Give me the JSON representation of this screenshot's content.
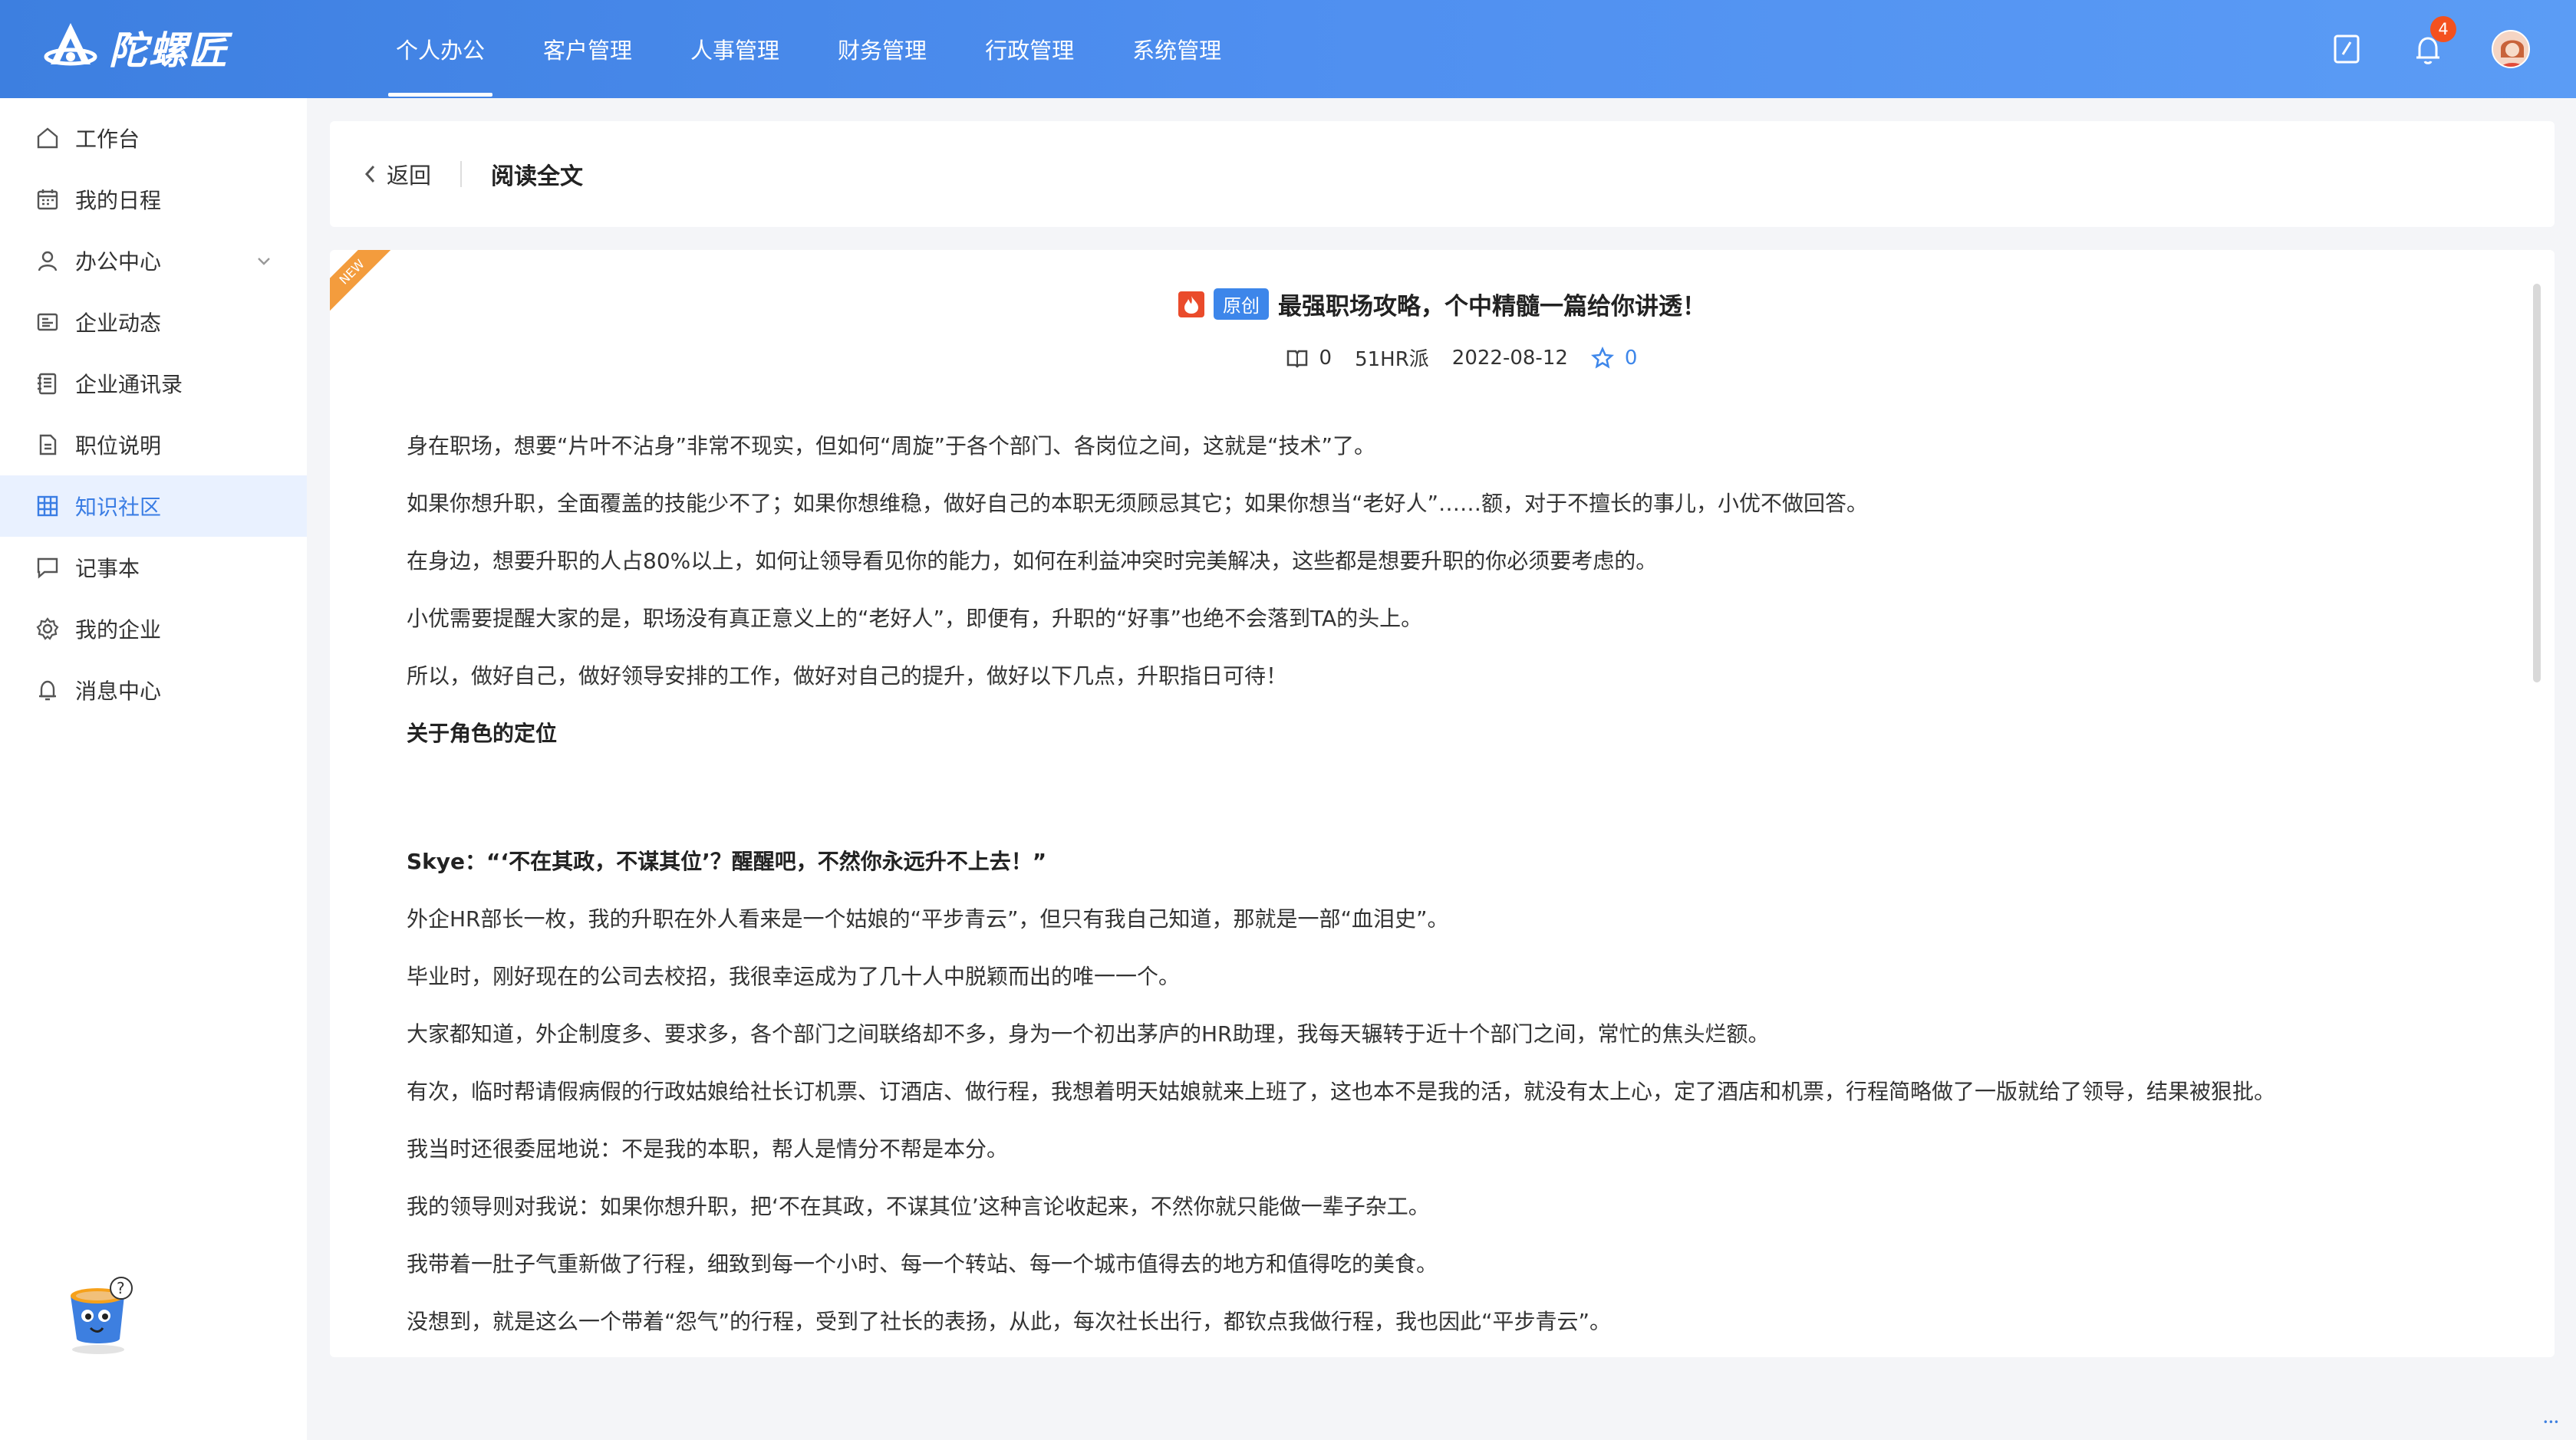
{
  "header": {
    "logo_text": "陀螺匠",
    "nav": [
      "个人办公",
      "客户管理",
      "人事管理",
      "财务管理",
      "行政管理",
      "系统管理"
    ],
    "active_nav": 0,
    "notification_count": "4"
  },
  "sidebar": {
    "items": [
      {
        "label": "工作台",
        "icon": "home-icon"
      },
      {
        "label": "我的日程",
        "icon": "calendar-icon"
      },
      {
        "label": "办公中心",
        "icon": "user-icon"
      },
      {
        "label": "企业动态",
        "icon": "news-icon"
      },
      {
        "label": "企业通讯录",
        "icon": "contacts-icon"
      },
      {
        "label": "职位说明",
        "icon": "document-icon"
      },
      {
        "label": "知识社区",
        "icon": "grid-icon"
      },
      {
        "label": "记事本",
        "icon": "chat-icon"
      },
      {
        "label": "我的企业",
        "icon": "gear-icon"
      },
      {
        "label": "消息中心",
        "icon": "bell-icon"
      }
    ],
    "active_index": 6
  },
  "breadcrumb": {
    "back_label": "返回",
    "title": "阅读全文"
  },
  "article": {
    "ribbon": "NEW",
    "tag": "原创",
    "title": "最强职场攻略，个中精髓一篇给你讲透！",
    "read_count": "0",
    "source": "51HR派",
    "date": "2022-08-12",
    "favorite_count": "0",
    "paragraphs_a": [
      "身在职场，想要“片叶不沾身”非常不现实，但如何“周旋”于各个部门、各岗位之间，这就是“技术”了。",
      "如果你想升职，全面覆盖的技能少不了；如果你想维稳，做好自己的本职无须顾忌其它；如果你想当“老好人”……额，对于不擅长的事儿，小优不做回答。",
      "在身边，想要升职的人占80%以上，如何让领导看见你的能力，如何在利益冲突时完美解决，这些都是想要升职的你必须要考虑的。",
      "小优需要提醒大家的是，职场没有真正意义上的“老好人”，即便有，升职的“好事”也绝不会落到TA的头上。",
      "所以，做好自己，做好领导安排的工作，做好对自己的提升，做好以下几点，升职指日可待！"
    ],
    "heading": "关于角色的定位",
    "quote": "Skye：“‘不在其政，不谋其位’？醒醒吧，不然你永远升不上去！”",
    "paragraphs_b": [
      "外企HR部长一枚，我的升职在外人看来是一个姑娘的“平步青云”，但只有我自己知道，那就是一部“血泪史”。",
      "毕业时，刚好现在的公司去校招，我很幸运成为了几十人中脱颖而出的唯一一个。",
      "大家都知道，外企制度多、要求多，各个部门之间联络却不多，身为一个初出茅庐的HR助理，我每天辗转于近十个部门之间，常忙的焦头烂额。",
      "有次，临时帮请假病假的行政姑娘给社长订机票、订酒店、做行程，我想着明天姑娘就来上班了，这也本不是我的活，就没有太上心，定了酒店和机票，行程简略做了一版就给了领导，结果被狠批。",
      "我当时还很委屈地说：不是我的本职，帮人是情分不帮是本分。",
      "我的领导则对我说：如果你想升职，把‘不在其政，不谋其位’这种言论收起来，不然你就只能做一辈子杂工。",
      "我带着一肚子气重新做了行程，细致到每一个小时、每一个转站、每一个城市值得去的地方和值得吃的美食。",
      "没想到，就是这么一个带着“怨气”的行程，受到了社长的表扬，从此，每次社长出行，都钦点我做行程，我也因此“平步青云”。"
    ]
  }
}
